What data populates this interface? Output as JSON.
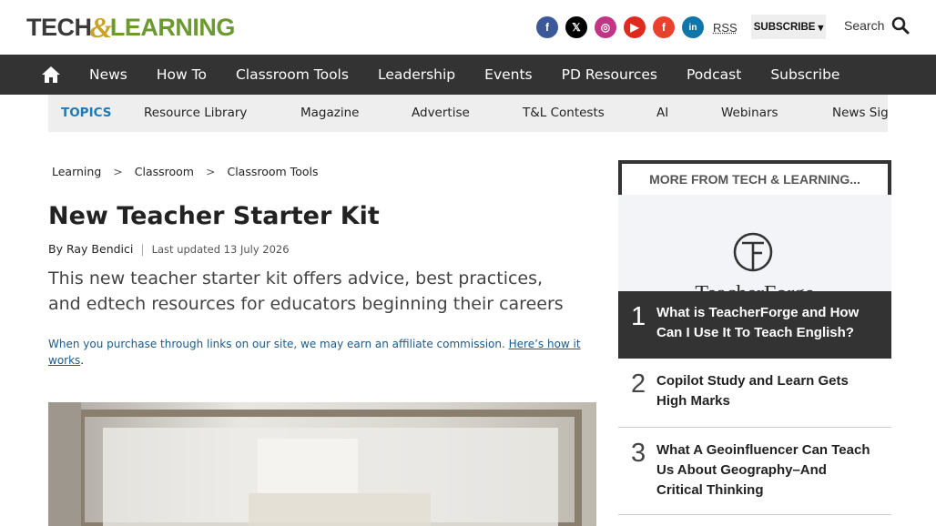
{
  "header": {
    "logo": {
      "part1": "TECH",
      "amp": "&",
      "part2": "LEARNING"
    },
    "social": [
      {
        "name": "facebook-icon",
        "glyph": "f"
      },
      {
        "name": "x-icon",
        "glyph": "𝕏"
      },
      {
        "name": "instagram-icon",
        "glyph": "◎"
      },
      {
        "name": "youtube-icon",
        "glyph": "▶"
      },
      {
        "name": "flipboard-icon",
        "glyph": "f"
      },
      {
        "name": "linkedin-icon",
        "glyph": "in"
      }
    ],
    "rss_label": "RSS",
    "subscribe_label": "SUBSCRIBE",
    "search_label": "Search"
  },
  "main_nav": {
    "items": [
      "News",
      "How To",
      "Classroom Tools",
      "Leadership",
      "Events",
      "PD Resources",
      "Podcast",
      "Subscribe"
    ]
  },
  "sub_nav": {
    "topics_label": "TOPICS",
    "items": [
      "Resource Library",
      "Magazine",
      "Advertise",
      "T&L Contests",
      "AI",
      "Webinars",
      "News Sign"
    ]
  },
  "breadcrumb": {
    "items": [
      "Learning",
      "Classroom",
      "Classroom Tools"
    ],
    "separator": ">"
  },
  "article": {
    "title": "New Teacher Starter Kit",
    "byline_prefix": "By",
    "author": "Ray Bendici",
    "updated": "Last updated 13 July 2026",
    "strapline": "This new teacher starter kit offers advice, best practices, and edtech resources for educators beginning their careers",
    "affiliate_text": "When you purchase through links on our site, we may earn an affiliate commission. ",
    "affiliate_link": "Here’s how it works",
    "affiliate_end": "."
  },
  "sidebar": {
    "heading": "MORE FROM TECH & LEARNING...",
    "promo_brand": "TeacherForge",
    "items": [
      {
        "num": "1",
        "title": "What is TeacherForge and How Can I Use It To Teach English?",
        "active": true
      },
      {
        "num": "2",
        "title": "Copilot Study and Learn Gets High Marks",
        "active": false
      },
      {
        "num": "3",
        "title": "What A Geoinfluencer Can Teach Us About Geography–And Critical Thinking",
        "active": false
      }
    ]
  },
  "colors": {
    "nav_bg": "#333333",
    "subnav_bg": "#eeeeee",
    "topics_accent": "#1e7ab8",
    "link": "#1b5a8a",
    "logo_green": "#6d9a2f",
    "logo_gold": "#c9a227"
  }
}
